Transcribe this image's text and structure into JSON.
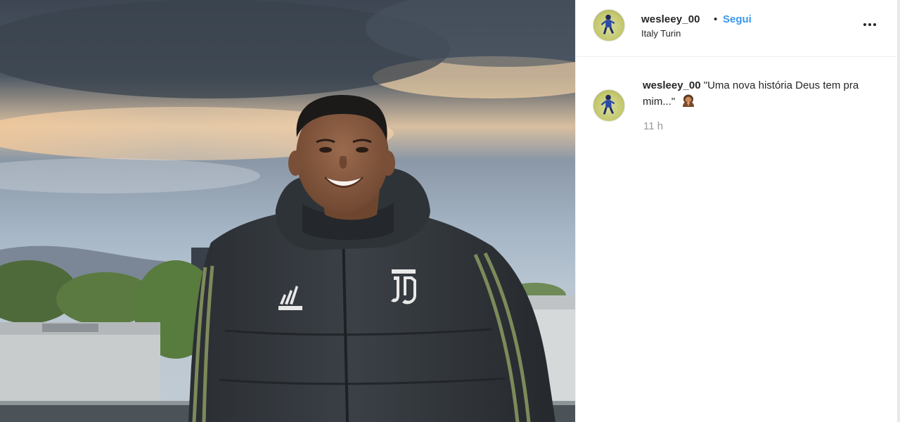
{
  "post": {
    "username": "wesleey_00",
    "separator": "•",
    "follow_label": "Segui",
    "location": "Italy Turin",
    "more_options_icon": "ellipsis-horizontal-icon"
  },
  "caption": {
    "username": "wesleey_00",
    "text": "\"Uma nova história Deus tem pra mim...\"",
    "emoji_icon": "praying-person-icon",
    "timestamp": "11 h"
  },
  "photo": {
    "jacket_brand_logo": "adidas",
    "club_crest": "Juventus J crest"
  },
  "colors": {
    "follow_blue": "#3897f0",
    "text_dark": "#262626",
    "timestamp_gray": "#999999",
    "avatar_green": "#c4c86e"
  }
}
